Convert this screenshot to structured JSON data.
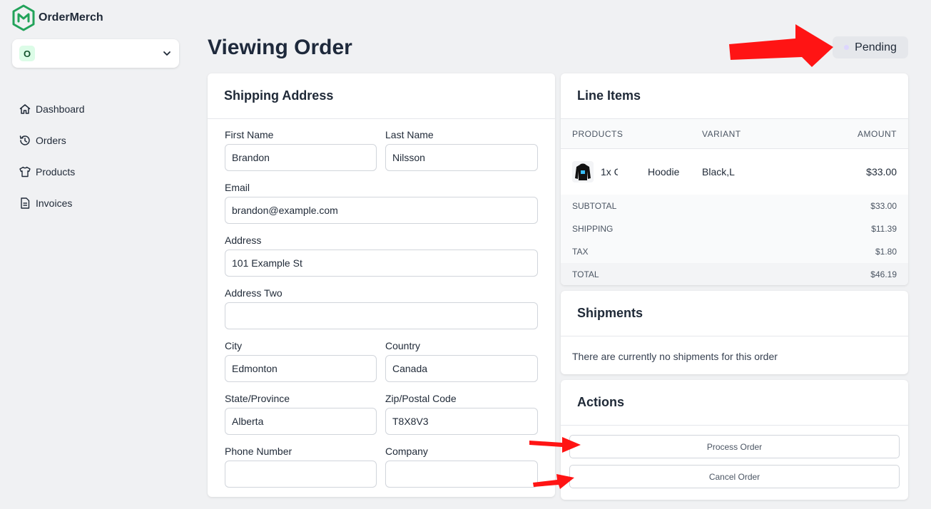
{
  "brand": {
    "name": "OrderMerch"
  },
  "org": {
    "initial": "O"
  },
  "nav": [
    {
      "label": "Dashboard",
      "icon": "home-icon"
    },
    {
      "label": "Orders",
      "icon": "history-icon"
    },
    {
      "label": "Products",
      "icon": "shirt-icon"
    },
    {
      "label": "Invoices",
      "icon": "document-icon"
    }
  ],
  "header": {
    "title": "Viewing Order",
    "status": "Pending"
  },
  "shipping": {
    "title": "Shipping Address",
    "first_name": {
      "label": "First Name",
      "value": "Brandon"
    },
    "last_name": {
      "label": "Last Name",
      "value": "Nilsson"
    },
    "email": {
      "label": "Email",
      "value": "brandon@example.com"
    },
    "address": {
      "label": "Address",
      "value": "101 Example St"
    },
    "address_two": {
      "label": "Address Two",
      "value": ""
    },
    "city": {
      "label": "City",
      "value": "Edmonton"
    },
    "country": {
      "label": "Country",
      "value": "Canada"
    },
    "state": {
      "label": "State/Province",
      "value": "Alberta"
    },
    "zip": {
      "label": "Zip/Postal Code",
      "value": "T8X8V3"
    },
    "phone": {
      "label": "Phone Number",
      "value": ""
    },
    "company": {
      "label": "Company",
      "value": ""
    }
  },
  "line_items": {
    "title": "Line Items",
    "columns": {
      "products": "PRODUCTS",
      "variant": "VARIANT",
      "amount": "AMOUNT"
    },
    "rows": [
      {
        "qty": "1x C",
        "name": "Hoodie",
        "variant": "Black,L",
        "amount": "$33.00"
      }
    ],
    "totals": {
      "subtotal": {
        "label": "SUBTOTAL",
        "value": "$33.00"
      },
      "shipping": {
        "label": "SHIPPING",
        "value": "$11.39"
      },
      "tax": {
        "label": "TAX",
        "value": "$1.80"
      },
      "total": {
        "label": "TOTAL",
        "value": "$46.19"
      }
    }
  },
  "shipments": {
    "title": "Shipments",
    "empty": "There are currently no shipments for this order"
  },
  "actions": {
    "title": "Actions",
    "process": "Process Order",
    "cancel": "Cancel Order"
  },
  "colors": {
    "brand": "#22a35a",
    "annotation_arrow": "#ff1414",
    "status_dot": "#ddd6fe"
  }
}
